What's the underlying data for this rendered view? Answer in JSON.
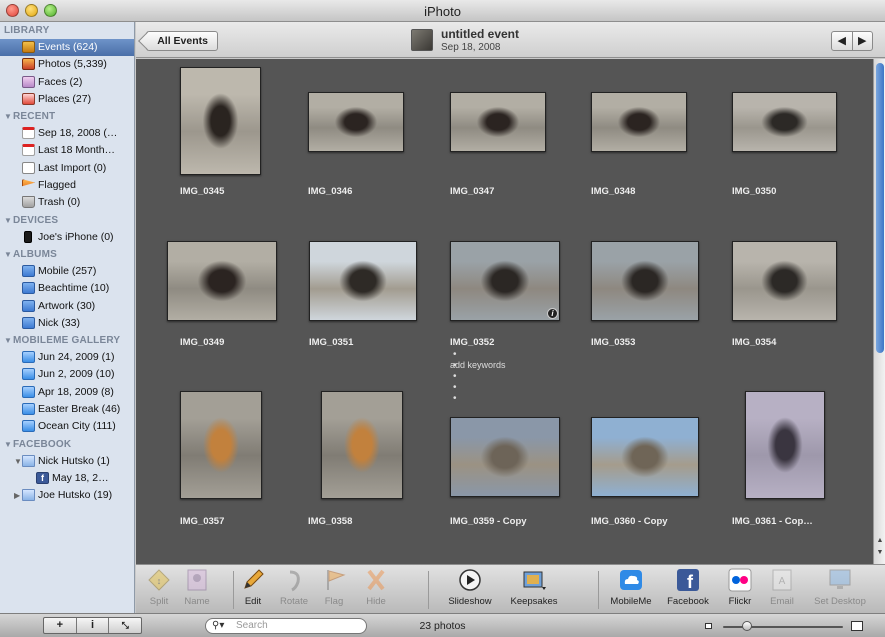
{
  "window": {
    "title": "iPhoto"
  },
  "sidebar": {
    "sections": [
      {
        "title": "LIBRARY",
        "has_triangle": false,
        "items": [
          {
            "label": "Events (624)",
            "icon": "events-icon",
            "selected": true,
            "level": 0
          },
          {
            "label": "Photos (5,339)",
            "icon": "photos-icon",
            "level": 0
          },
          {
            "label": "Faces (2)",
            "icon": "faces-icon",
            "level": 0
          },
          {
            "label": "Places (27)",
            "icon": "places-icon",
            "level": 0
          }
        ]
      },
      {
        "title": "RECENT",
        "has_triangle": true,
        "items": [
          {
            "label": "Sep 18, 2008 (…",
            "icon": "calendar-icon",
            "level": 0
          },
          {
            "label": "Last 18 Month…",
            "icon": "calendar-icon",
            "level": 0
          },
          {
            "label": "Last Import (0)",
            "icon": "import-icon",
            "level": 0
          },
          {
            "label": "Flagged",
            "icon": "flag-icon",
            "level": 0
          },
          {
            "label": "Trash (0)",
            "icon": "trash-icon",
            "level": 0
          }
        ]
      },
      {
        "title": "DEVICES",
        "has_triangle": true,
        "items": [
          {
            "label": "Joe's iPhone (0)",
            "icon": "iphone-icon",
            "level": 0
          }
        ]
      },
      {
        "title": "ALBUMS",
        "has_triangle": true,
        "items": [
          {
            "label": "Mobile (257)",
            "icon": "album-icon",
            "level": 0
          },
          {
            "label": "Beachtime (10)",
            "icon": "album-icon",
            "level": 0
          },
          {
            "label": "Artwork (30)",
            "icon": "album-icon",
            "level": 0
          },
          {
            "label": "Nick (33)",
            "icon": "album-icon",
            "level": 0
          }
        ]
      },
      {
        "title": "MOBILEME GALLERY",
        "has_triangle": true,
        "items": [
          {
            "label": "Jun 24, 2009 (1)",
            "icon": "mobileme-gallery-icon",
            "level": 0
          },
          {
            "label": "Jun 2, 2009 (10)",
            "icon": "mobileme-gallery-icon",
            "level": 0
          },
          {
            "label": "Apr 18, 2009 (8)",
            "icon": "mobileme-gallery-icon",
            "level": 0
          },
          {
            "label": "Easter Break (46)",
            "icon": "mobileme-gallery-icon",
            "level": 0
          },
          {
            "label": "Ocean City (111)",
            "icon": "mobileme-gallery-icon",
            "level": 0
          }
        ]
      },
      {
        "title": "FACEBOOK",
        "has_triangle": true,
        "items": [
          {
            "label": "Nick Hutsko (1)",
            "icon": "folder-icon",
            "level": 0,
            "disclosure": "▼"
          },
          {
            "label": "May 18, 2…",
            "icon": "facebook-album-icon",
            "level": 1
          },
          {
            "label": "Joe Hutsko (19)",
            "icon": "folder-icon",
            "level": 0,
            "disclosure": "▶"
          }
        ]
      }
    ]
  },
  "topbar": {
    "back_label": "All Events",
    "event_title": "untitled event",
    "event_date": "Sep 18, 2008",
    "prev_arrow": "🡐",
    "next_arrow": "🡒"
  },
  "photos": [
    {
      "name": "IMG_0345",
      "theme": "beach-woman"
    },
    {
      "name": "IMG_0346",
      "theme": "beach-woman-dog"
    },
    {
      "name": "IMG_0347",
      "theme": "beach-woman-dog"
    },
    {
      "name": "IMG_0348",
      "theme": "beach-woman-dog"
    },
    {
      "name": "IMG_0350",
      "theme": "beach-man-dog"
    },
    {
      "name": "IMG_0349",
      "theme": "beach-woman-dog"
    },
    {
      "name": "IMG_0351",
      "theme": "beach-wide"
    },
    {
      "name": "IMG_0352",
      "theme": "beach-wide-man",
      "has_info": true,
      "keywords": "add keywords",
      "rating_dots": "• • • • •"
    },
    {
      "name": "IMG_0353",
      "theme": "beach-wide-man"
    },
    {
      "name": "IMG_0354",
      "theme": "beach-man-dog"
    },
    {
      "name": "IMG_0357",
      "theme": "dog-sand"
    },
    {
      "name": "IMG_0358",
      "theme": "dog-sand"
    },
    {
      "name": "IMG_0359 - Copy",
      "theme": "sandcastle"
    },
    {
      "name": "IMG_0360 - Copy",
      "theme": "sandcastle-sea"
    },
    {
      "name": "IMG_0361 - Cop…",
      "theme": "shadow-sand"
    }
  ],
  "toolbar": {
    "tools": [
      {
        "label": "Split",
        "icon": "split-icon",
        "enabled": false
      },
      {
        "label": "Name",
        "icon": "name-icon",
        "enabled": false
      },
      {
        "label": "Edit",
        "icon": "pencil-icon",
        "enabled": true
      },
      {
        "label": "Rotate",
        "icon": "rotate-icon",
        "enabled": false
      },
      {
        "label": "Flag",
        "icon": "flag-icon",
        "enabled": false
      },
      {
        "label": "Hide",
        "icon": "hide-x-icon",
        "enabled": false
      },
      {
        "label": "Slideshow",
        "icon": "play-icon",
        "enabled": true
      },
      {
        "label": "Keepsakes",
        "icon": "keepsakes-icon",
        "enabled": true
      },
      {
        "label": "MobileMe",
        "icon": "mobileme-cloud-icon",
        "enabled": true
      },
      {
        "label": "Facebook",
        "icon": "facebook-icon",
        "enabled": true
      },
      {
        "label": "Flickr",
        "icon": "flickr-icon",
        "enabled": true
      },
      {
        "label": "Email",
        "icon": "email-icon",
        "enabled": false
      },
      {
        "label": "Set Desktop",
        "icon": "desktop-icon",
        "enabled": false
      }
    ]
  },
  "bottombar": {
    "add_label": "+",
    "info_label": "i",
    "fullscreen_label": "⤡",
    "search_placeholder": "Search",
    "photo_count": "23 photos",
    "zoom_level": 0.2
  },
  "colors": {
    "sidebar_bg": "#dbe3ee",
    "selection": "#4a6fa8",
    "grid_bg": "#555555",
    "caption": "#eeeeee"
  }
}
